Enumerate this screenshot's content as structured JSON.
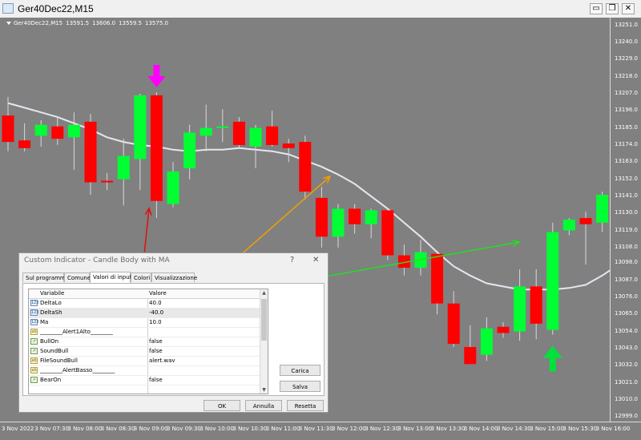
{
  "window": {
    "title": "Ger40Dec22,M15"
  },
  "window_buttons": {
    "minimize": "▭",
    "restore": "❐",
    "close": "✕"
  },
  "chart_header": {
    "symbol": "Ger40Dec22,M15",
    "open": "13591.5",
    "high": "13606.0",
    "low": "13559.5",
    "close": "13575.0"
  },
  "colors": {
    "background": "#808080",
    "bull_candle": "#00ff33",
    "bear_candle": "#ff0000",
    "moving_average": "#e6e6f0",
    "sell_arrow": "#ff00ff",
    "buy_arrow": "#00e23a",
    "annotation_red": "#e01010",
    "annotation_orange": "#f0a000",
    "annotation_green": "#20e020"
  },
  "chart_data": {
    "type": "candlestick",
    "ylim": [
      12996,
      13256
    ],
    "y_ticks": [
      "13251.0",
      "13240.0",
      "13229.0",
      "13218.0",
      "13207.0",
      "13196.0",
      "13185.0",
      "13174.0",
      "13163.0",
      "13152.0",
      "13141.0",
      "13130.0",
      "13119.0",
      "13108.0",
      "13098.0",
      "13087.0",
      "13076.0",
      "13065.0",
      "13054.0",
      "13043.0",
      "13032.0",
      "13021.0",
      "13010.0",
      "12999.0"
    ],
    "x_ticks": [
      "3 Nov 2022",
      "3 Nov 07:30",
      "3 Nov 08:00",
      "3 Nov 08:30",
      "3 Nov 09:00",
      "3 Nov 09:30",
      "3 Nov 10:00",
      "3 Nov 10:30",
      "3 Nov 11:00",
      "3 Nov 11:30",
      "3 Nov 12:00",
      "3 Nov 12:30",
      "3 Nov 13:00",
      "3 Nov 13:30",
      "3 Nov 14:00",
      "3 Nov 14:30",
      "3 Nov 15:00",
      "3 Nov 15:30",
      "3 Nov 16:00"
    ],
    "candles": [
      {
        "o": 13193,
        "h": 13205,
        "l": 13170,
        "c": 13176
      },
      {
        "o": 13177,
        "h": 13188,
        "l": 13170,
        "c": 13172
      },
      {
        "o": 13180,
        "h": 13190,
        "l": 13173,
        "c": 13187
      },
      {
        "o": 13186,
        "h": 13192,
        "l": 13174,
        "c": 13178
      },
      {
        "o": 13179,
        "h": 13195,
        "l": 13158,
        "c": 13187
      },
      {
        "o": 13189,
        "h": 13194,
        "l": 13142,
        "c": 13150
      },
      {
        "o": 13151,
        "h": 13156,
        "l": 13145,
        "c": 13150
      },
      {
        "o": 13152,
        "h": 13178,
        "l": 13135,
        "c": 13167
      },
      {
        "o": 13165,
        "h": 13207,
        "l": 13145,
        "c": 13206
      },
      {
        "o": 13206,
        "h": 13208,
        "l": 13127,
        "c": 13138
      },
      {
        "o": 13136,
        "h": 13163,
        "l": 13134,
        "c": 13157
      },
      {
        "o": 13159,
        "h": 13187,
        "l": 13152,
        "c": 13182
      },
      {
        "o": 13180,
        "h": 13200,
        "l": 13170,
        "c": 13185
      },
      {
        "o": 13186,
        "h": 13197,
        "l": 13176,
        "c": 13186
      },
      {
        "o": 13189,
        "h": 13192,
        "l": 13172,
        "c": 13174
      },
      {
        "o": 13173,
        "h": 13187,
        "l": 13159,
        "c": 13185
      },
      {
        "o": 13186,
        "h": 13196,
        "l": 13173,
        "c": 13174
      },
      {
        "o": 13175,
        "h": 13178,
        "l": 13163,
        "c": 13172
      },
      {
        "o": 13176,
        "h": 13180,
        "l": 13139,
        "c": 13144
      },
      {
        "o": 13140,
        "h": 13147,
        "l": 13108,
        "c": 13115
      },
      {
        "o": 13115,
        "h": 13136,
        "l": 13108,
        "c": 13133
      },
      {
        "o": 13133,
        "h": 13136,
        "l": 13117,
        "c": 13123
      },
      {
        "o": 13123,
        "h": 13133,
        "l": 13114,
        "c": 13132
      },
      {
        "o": 13132,
        "h": 13133,
        "l": 13100,
        "c": 13103
      },
      {
        "o": 13103,
        "h": 13110,
        "l": 13090,
        "c": 13095
      },
      {
        "o": 13095,
        "h": 13113,
        "l": 13090,
        "c": 13105
      },
      {
        "o": 13104,
        "h": 13106,
        "l": 13065,
        "c": 13072
      },
      {
        "o": 13072,
        "h": 13080,
        "l": 13044,
        "c": 13046
      },
      {
        "o": 13044,
        "h": 13058,
        "l": 13033,
        "c": 13033
      },
      {
        "o": 13039,
        "h": 13063,
        "l": 13035,
        "c": 13056
      },
      {
        "o": 13057,
        "h": 13060,
        "l": 13050,
        "c": 13053
      },
      {
        "o": 13054,
        "h": 13094,
        "l": 13048,
        "c": 13083
      },
      {
        "o": 13083,
        "h": 13094,
        "l": 13049,
        "c": 13059
      },
      {
        "o": 13055,
        "h": 13124,
        "l": 13052,
        "c": 13118
      },
      {
        "o": 13119,
        "h": 13127,
        "l": 13116,
        "c": 13126
      },
      {
        "o": 13127,
        "h": 13131,
        "l": 13097,
        "c": 13123
      },
      {
        "o": 13124,
        "h": 13144,
        "l": 13118,
        "c": 13142
      },
      {
        "o": 13143,
        "h": 13150,
        "l": 13128,
        "c": 13130
      }
    ],
    "moving_average": [
      13201,
      13198,
      13195,
      13192,
      13188,
      13184,
      13179,
      13176,
      13174,
      13173,
      13171,
      13170,
      13171,
      13171,
      13172,
      13171,
      13170,
      13168,
      13164,
      13160,
      13155,
      13149,
      13141,
      13133,
      13124,
      13115,
      13105,
      13096,
      13090,
      13085,
      13083,
      13081,
      13081,
      13081,
      13082,
      13084,
      13090,
      13097
    ],
    "sell_arrow_candle": 9,
    "buy_arrow_candle": 33
  },
  "dialog": {
    "title": "Custom Indicator - Candle Body with MA",
    "help": "?",
    "close": "✕",
    "tabs": [
      "Sul programma",
      "Comune",
      "Valori di input",
      "Colori",
      "Visualizzazione"
    ],
    "active_tab": "Valori di input",
    "headers": {
      "variable": "Variabile",
      "value": "Valore"
    },
    "rows": [
      {
        "icon": "123",
        "variable": "DeltaLo",
        "value": "40.0"
      },
      {
        "icon": "123",
        "variable": "DeltaSh",
        "value": "-40.0"
      },
      {
        "icon": "123",
        "variable": "Ma",
        "value": "10.0"
      },
      {
        "icon": "ab",
        "variable": "________Alert1Alto________",
        "value": ""
      },
      {
        "icon": "↗",
        "variable": "BullOn",
        "value": "false"
      },
      {
        "icon": "↗",
        "variable": "SoundBull",
        "value": "false"
      },
      {
        "icon": "ab",
        "variable": "FileSoundBull",
        "value": "alert.wav"
      },
      {
        "icon": "ab",
        "variable": "________AlertBasso________",
        "value": ""
      },
      {
        "icon": "↗",
        "variable": "BearOn",
        "value": "false"
      }
    ],
    "scroll_up": "▲",
    "scroll_down": "▼",
    "buttons": {
      "load": "Carica",
      "save": "Salva",
      "ok": "OK",
      "cancel": "Annulla",
      "reset": "Resetta"
    }
  }
}
